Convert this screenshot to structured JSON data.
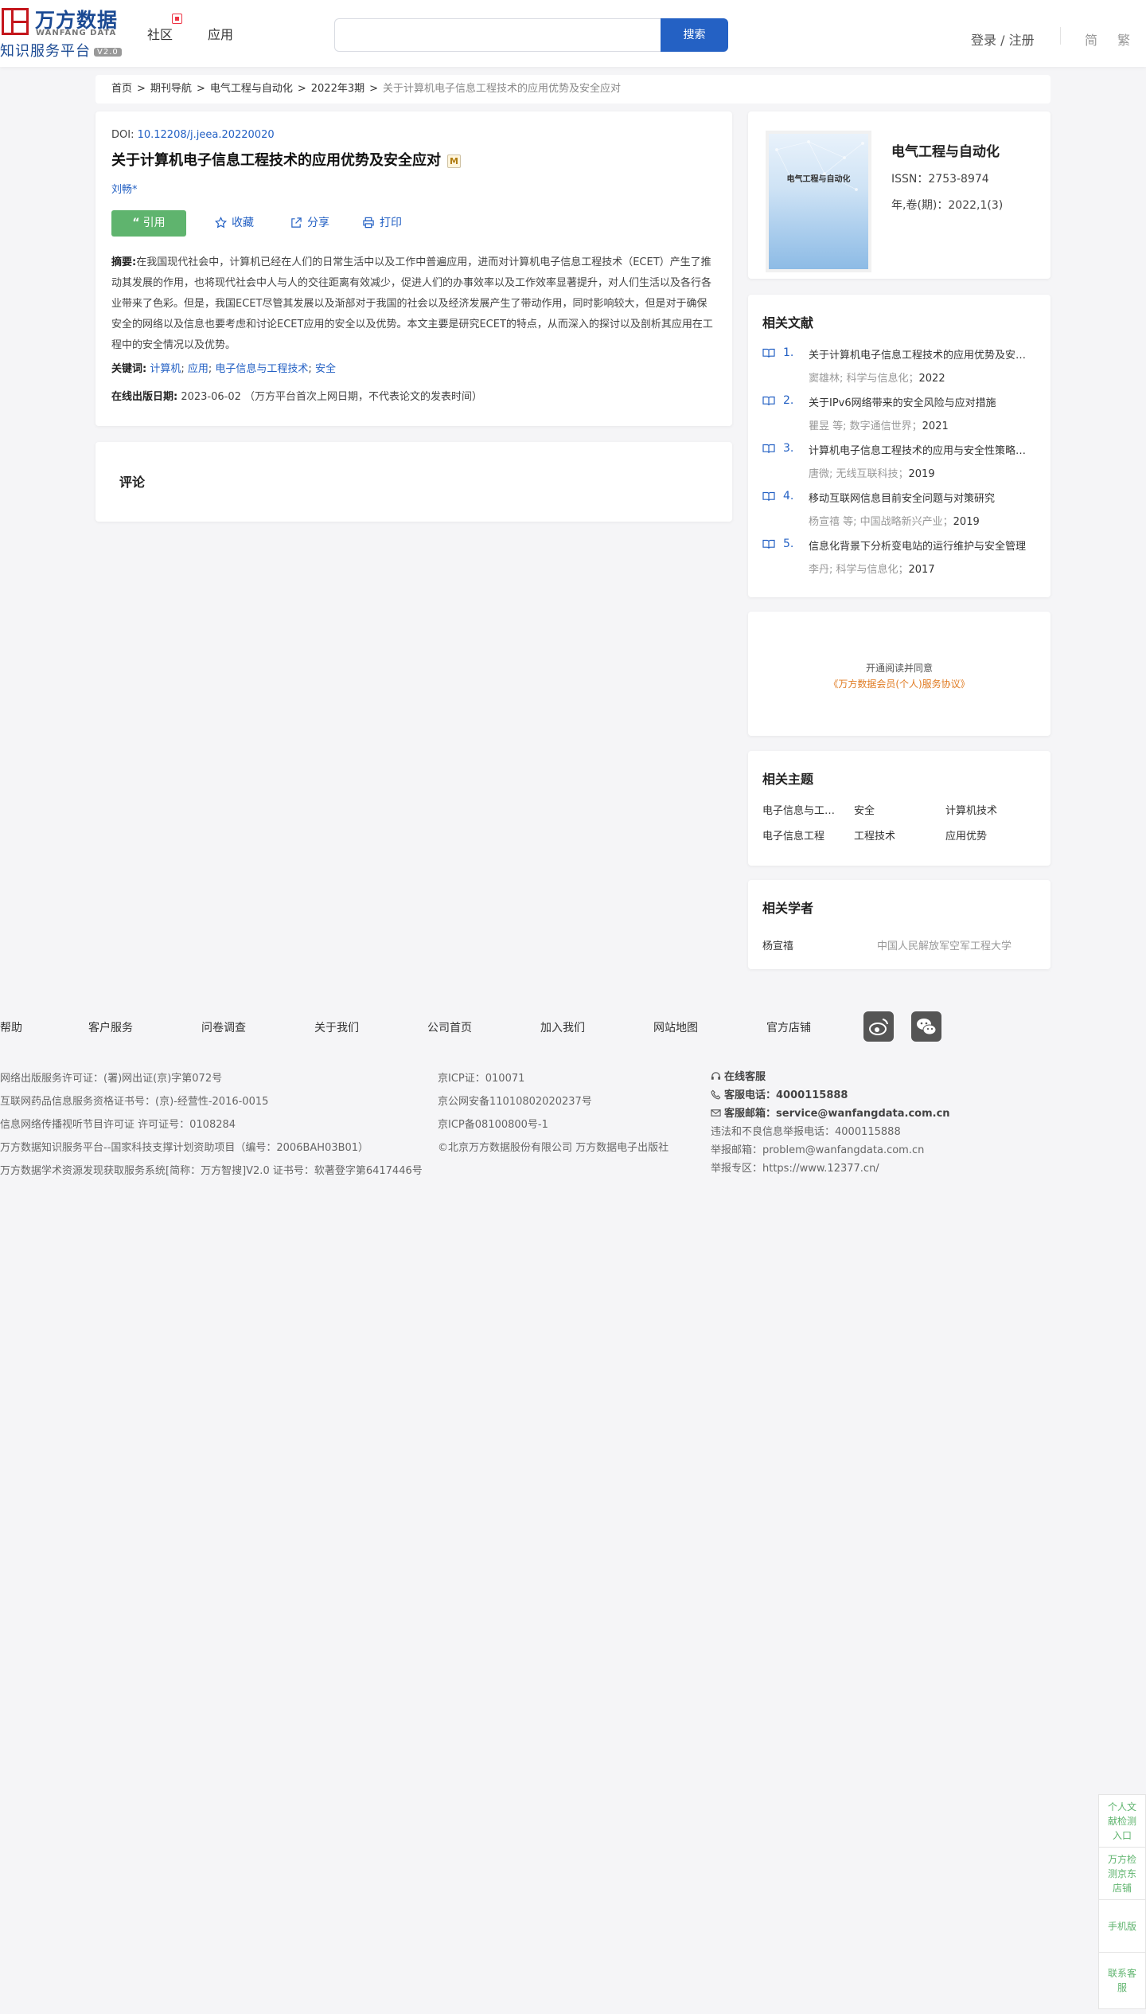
{
  "header": {
    "logo_cn": "万方数据",
    "logo_en": "WANFANG DATA",
    "logo_sub": "知识服务平台",
    "logo_version": "V2.0",
    "nav": [
      "社区",
      "应用"
    ],
    "search_placeholder": "",
    "search_button": "搜索",
    "login": "登录 / 注册",
    "lang_simplified": "简",
    "lang_traditional": "繁"
  },
  "breadcrumb": [
    "首页",
    "期刊导航",
    "电气工程与自动化",
    "2022年3期",
    "关于计算机电子信息工程技术的应用优势及安全应对"
  ],
  "article": {
    "doi_label": "DOI: ",
    "doi": "10.12208/j.jeea.20220020",
    "title": "关于计算机电子信息工程技术的应用优势及安全应对",
    "author": "刘畅*",
    "cite": "引用",
    "favorite": "收藏",
    "share": "分享",
    "print": "打印",
    "abstract_label": "摘要:",
    "abstract": "在我国现代社会中，计算机已经在人们的日常生活中以及工作中普遍应用，进而对计算机电子信息工程技术（ECET）产生了推动其发展的作用，也将现代社会中人与人的交往距离有效减少，促进人们的办事效率以及工作效率显著提升，对人们生活以及各行各业带来了色彩。但是，我国ECET尽管其发展以及渐部对于我国的社会以及经济发展产生了带动作用，同时影响较大，但是对于确保安全的网络以及信息也要考虑和讨论ECET应用的安全以及优势。本文主要是研究ECET的特点，从而深入的探讨以及剖析其应用在工程中的安全情况以及优势。",
    "keywords_label": "关键词:",
    "keywords": [
      "计算机",
      "应用",
      "电子信息与工程技术",
      "安全"
    ],
    "pubdate_label": "在线出版日期:",
    "pubdate": "2023-06-02 （万方平台首次上网日期，不代表论文的发表时间）"
  },
  "comment_title": "评论",
  "journal": {
    "name": "电气工程与自动化",
    "cover_text": "电气工程与自动化",
    "issn": "ISSN：2753-8974",
    "volume": "年,卷(期)：2022,1(3)"
  },
  "related": {
    "title": "相关文献",
    "items": [
      {
        "num": "1.",
        "title": "关于计算机电子信息工程技术的应用优势及安全应对",
        "meta": "窦雄林; 科学与信息化；",
        "year": "2022"
      },
      {
        "num": "2.",
        "title": "关于IPv6网络带来的安全风险与应对措施",
        "meta": "瞿昱  等;  数字通信世界；",
        "year": "2021"
      },
      {
        "num": "3.",
        "title": "计算机电子信息工程技术的应用与安全性策略探讨",
        "meta": "唐微; 无线互联科技；",
        "year": "2019"
      },
      {
        "num": "4.",
        "title": "移动互联网信息目前安全问题与对策研究",
        "meta": "杨宣禧  等;  中国战略新兴产业；",
        "year": "2019"
      },
      {
        "num": "5.",
        "title": "信息化背景下分析变电站的运行维护与安全管理",
        "meta": "李丹; 科学与信息化；",
        "year": "2017"
      }
    ]
  },
  "agreement": {
    "line1": "开通阅读并同意",
    "line2": "《万方数据会员(个人)服务协议》"
  },
  "topics": {
    "title": "相关主题",
    "items": [
      "电子信息与工程技术",
      "安全",
      "计算机技术",
      "电子信息工程",
      "工程技术",
      "应用优势"
    ]
  },
  "scholars": {
    "title": "相关学者",
    "name": "杨宣禧",
    "org": "中国人民解放军空军工程大学"
  },
  "footer": {
    "nav": [
      "帮助",
      "客户服务",
      "问卷调查",
      "关于我们",
      "公司首页",
      "加入我们",
      "网站地图",
      "官方店铺"
    ],
    "col1": [
      "网络出版服务许可证：(署)网出证(京)字第072号",
      "互联网药品信息服务资格证书号：(京)-经营性-2016-0015",
      "信息网络传播视听节目许可证 许可证号：0108284",
      "万方数据知识服务平台--国家科技支撑计划资助项目（编号：2006BAH03B01）",
      "万方数据学术资源发现获取服务系统[简称：万方智搜]V2.0 证书号：软著登字第6417446号"
    ],
    "col2": [
      "京ICP证：010071",
      "京公网安备11010802020237号",
      "京ICP备08100800号-1",
      "©北京万方数据股份有限公司 万方数据电子出版社"
    ],
    "online_service": "在线客服",
    "phone_label": "客服电话：",
    "phone": "4000115888",
    "email_label": "客服邮箱：",
    "email": "service@wanfangdata.com.cn",
    "col3": [
      "违法和不良信息举报电话：4000115888",
      "举报邮箱：problem@wanfangdata.com.cn",
      "举报专区：https://www.12377.cn/"
    ]
  },
  "sidebar": [
    "个人文献检测入口",
    "万方检测京东店铺",
    "手机版",
    "联系客服"
  ]
}
